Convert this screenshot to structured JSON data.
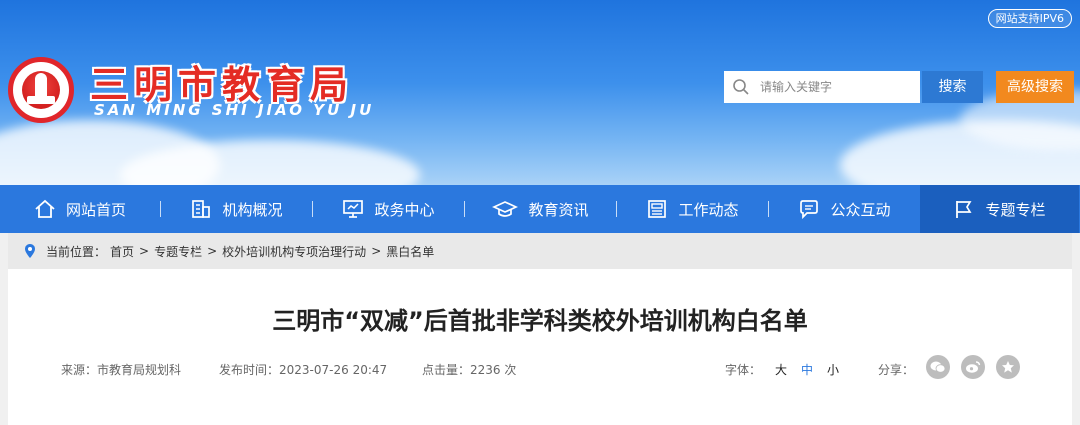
{
  "header": {
    "ipv6_badge": "网站支持IPV6",
    "site_title": "三明市教育局",
    "site_pinyin": "SAN MING SHI JIAO YU JU",
    "search": {
      "placeholder": "请输入关键字",
      "button_label": "搜索",
      "advanced_label": "高级搜索"
    },
    "colors": {
      "brand_red": "#e42c24",
      "nav_blue": "#2b78de",
      "nav_active": "#1b5fbe",
      "advanced_orange": "#f2891e"
    }
  },
  "nav": {
    "items": [
      {
        "label": "网站首页",
        "icon": "home-icon"
      },
      {
        "label": "机构概况",
        "icon": "building-icon"
      },
      {
        "label": "政务中心",
        "icon": "presentation-board-icon"
      },
      {
        "label": "教育资讯",
        "icon": "graduation-cap-icon"
      },
      {
        "label": "工作动态",
        "icon": "newspaper-icon"
      },
      {
        "label": "公众互动",
        "icon": "chat-icon"
      },
      {
        "label": "专题专栏",
        "icon": "flag-icon",
        "active": true
      }
    ]
  },
  "breadcrumb": {
    "prefix": "当前位置：",
    "items": [
      "首页",
      "专题专栏",
      "校外培训机构专项治理行动",
      "黑白名单"
    ],
    "separator": ">"
  },
  "article": {
    "title": "三明市“双减”后首批非学科类校外培训机构白名单",
    "source_label": "来源：",
    "source": "市教育局规划科",
    "time_label": "发布时间：",
    "time": "2023-07-26 20:47",
    "views_label": "点击量：",
    "views": "2236 次",
    "font_label": "字体：",
    "font_sizes": [
      "大",
      "中",
      "小"
    ],
    "share_label": "分享：",
    "share_icons": [
      "wechat-icon",
      "weibo-icon",
      "favorite-star-icon"
    ]
  }
}
